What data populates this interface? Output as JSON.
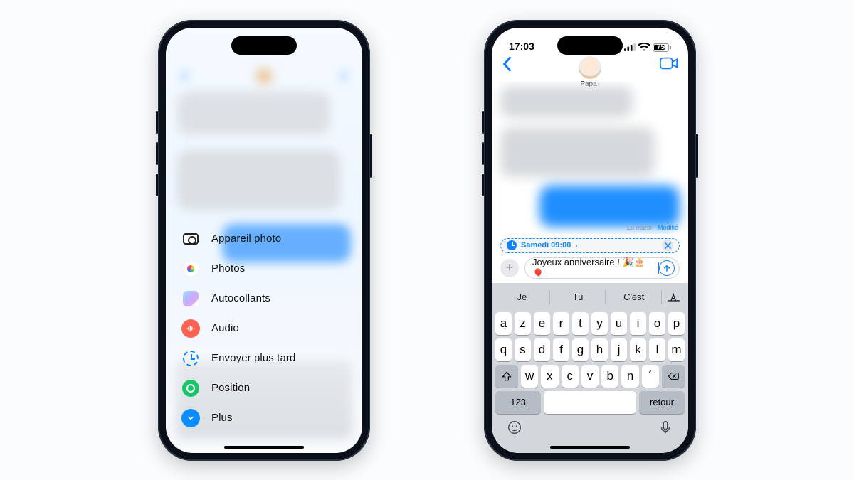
{
  "left": {
    "menu": [
      {
        "name": "camera",
        "label": "Appareil photo"
      },
      {
        "name": "photos",
        "label": "Photos"
      },
      {
        "name": "stickers",
        "label": "Autocollants"
      },
      {
        "name": "audio",
        "label": "Audio"
      },
      {
        "name": "sendlater",
        "label": "Envoyer plus tard"
      },
      {
        "name": "location",
        "label": "Position"
      },
      {
        "name": "more",
        "label": "Plus"
      }
    ]
  },
  "right": {
    "status": {
      "time": "17:03",
      "battery_pct": "75"
    },
    "contact_name": "Papa",
    "read_receipt_prefix": "Lu mardi · ",
    "read_receipt_edited": "Modifié",
    "schedule_label": "Samedi 09:00",
    "compose_text": "Joyeux anniversaire ! 🎉🎂🎈",
    "predictions": [
      "Je",
      "Tu",
      "C'est"
    ],
    "keyboard": {
      "row1": [
        "a",
        "z",
        "e",
        "r",
        "t",
        "y",
        "u",
        "i",
        "o",
        "p"
      ],
      "row2": [
        "q",
        "s",
        "d",
        "f",
        "g",
        "h",
        "j",
        "k",
        "l",
        "m"
      ],
      "row3": [
        "w",
        "x",
        "c",
        "v",
        "b",
        "n",
        "´"
      ],
      "num_key": "123",
      "return_key": "retour"
    }
  }
}
